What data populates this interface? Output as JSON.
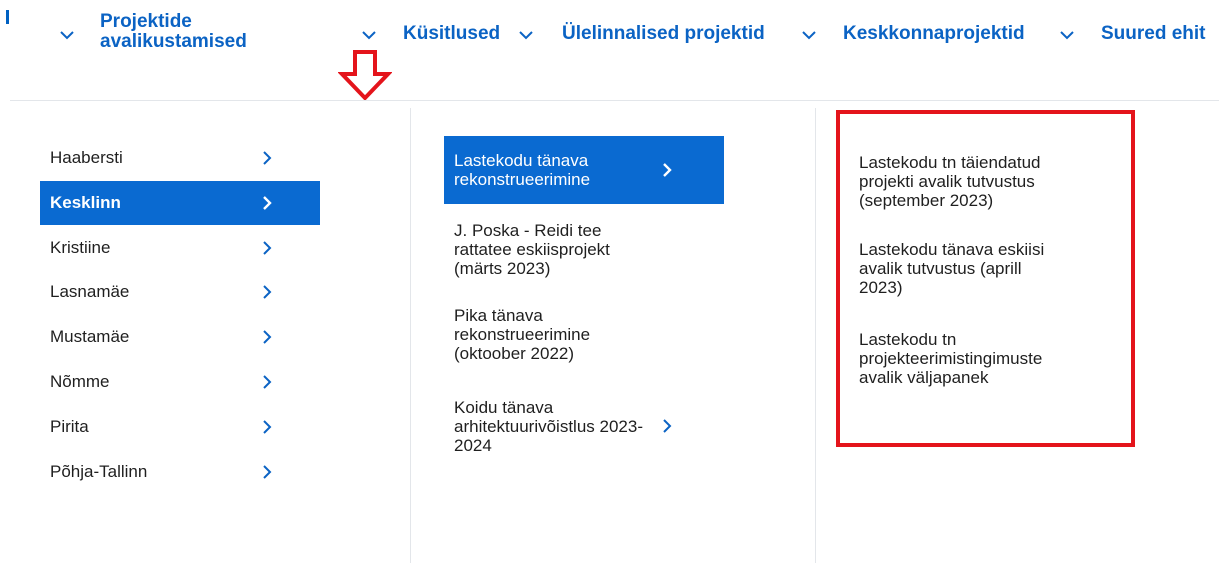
{
  "topnav": {
    "items": [
      {
        "label_line1": "Projektide",
        "label_line2": "avalikustamised"
      },
      {
        "label": "Küsitlused"
      },
      {
        "label": "Ülelinnalised projektid"
      },
      {
        "label": "Keskkonnaprojektid"
      },
      {
        "label": "Suured ehit"
      }
    ]
  },
  "districts": [
    {
      "label": "Haabersti"
    },
    {
      "label": "Kesklinn"
    },
    {
      "label": "Kristiine"
    },
    {
      "label": "Lasnamäe"
    },
    {
      "label": "Mustamäe"
    },
    {
      "label": "Nõmme"
    },
    {
      "label": "Pirita"
    },
    {
      "label": "Põhja-Tallinn"
    }
  ],
  "projects": [
    {
      "label": "Lastekodu tänava rekonstrueerimine"
    },
    {
      "label": "J. Poska - Reidi tee rattatee eskiisprojekt (märts 2023)"
    },
    {
      "label": "Pika tänava rekonstrueerimine (oktoober 2022)"
    },
    {
      "label": "Koidu tänava arhitektuurivõistlus 2023-2024"
    }
  ],
  "documents": [
    {
      "label": "Lastekodu tn täiendatud projekti avalik tutvustus (september 2023)"
    },
    {
      "label": "Lastekodu tänava eskiisi avalik tutvustus (aprill 2023)"
    },
    {
      "label": "Lastekodu tn projekteerimistingimuste avalik väljapanek"
    }
  ],
  "colors": {
    "nav_text": "#0b63c4",
    "active_bg": "#0a6ad1",
    "highlight": "#e4141b"
  }
}
